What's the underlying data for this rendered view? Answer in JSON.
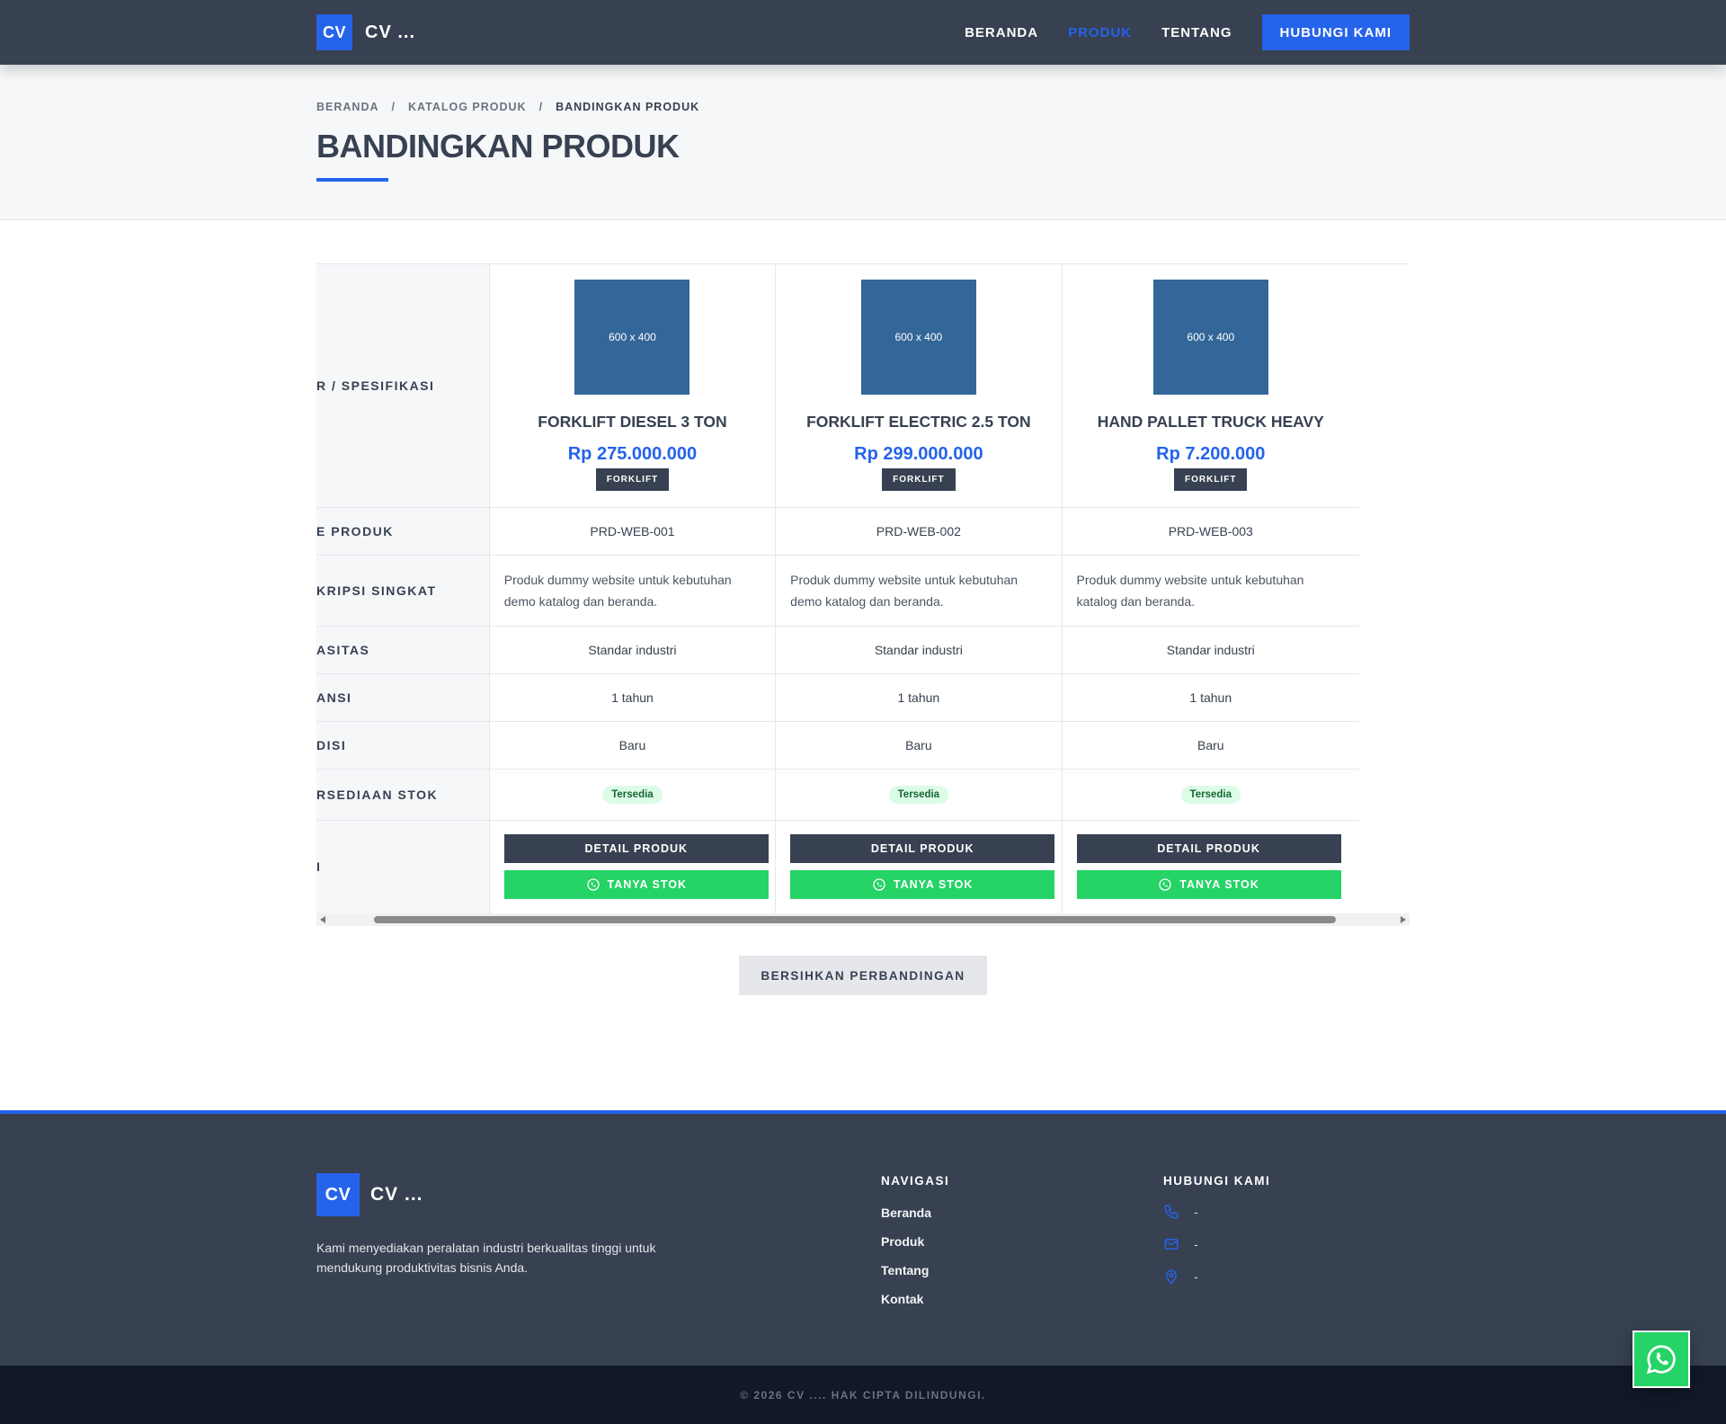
{
  "header": {
    "logo": "CV",
    "brand": "CV ...",
    "nav": [
      "BERANDA",
      "PRODUK",
      "TENTANG"
    ],
    "cta": "HUBUNGI KAMI"
  },
  "breadcrumb": [
    "BERANDA",
    "KATALOG PRODUK",
    "BANDINGKAN PRODUK"
  ],
  "page_title": "BANDINGKAN PRODUK",
  "compare": {
    "row_labels": {
      "header": "R / SPESIFIKASI",
      "code": "E PRODUK",
      "desc": "KRIPSI SINGKAT",
      "capacity": "ASITAS",
      "warranty": "ANSI",
      "condition": "DISI",
      "stock": "RSEDIAAN STOK",
      "action": "I"
    },
    "products": [
      {
        "image": "600 x 400",
        "name": "FORKLIFT DIESEL 3 TON",
        "price": "Rp 275.000.000",
        "category": "FORKLIFT",
        "code": "PRD-WEB-001",
        "desc_1": "Produk dummy website untuk kebutuhan",
        "desc_2": "demo katalog dan beranda.",
        "capacity": "Standar industri",
        "warranty": "1 tahun",
        "condition": "Baru",
        "stock": "Tersedia"
      },
      {
        "image": "600 x 400",
        "name": "FORKLIFT ELECTRIC 2.5 TON",
        "price": "Rp 299.000.000",
        "category": "FORKLIFT",
        "code": "PRD-WEB-002",
        "desc_1": "Produk dummy website untuk kebutuhan",
        "desc_2": "demo katalog dan beranda.",
        "capacity": "Standar industri",
        "warranty": "1 tahun",
        "condition": "Baru",
        "stock": "Tersedia"
      },
      {
        "image": "600 x 400",
        "name": "HAND PALLET TRUCK HEAVY",
        "price": "Rp 7.200.000",
        "category": "FORKLIFT",
        "code": "PRD-WEB-003",
        "desc_1": "Produk dummy website untuk kebutuhan",
        "desc_2": "katalog dan beranda.",
        "capacity": "Standar industri",
        "warranty": "1 tahun",
        "condition": "Baru",
        "stock": "Tersedia"
      }
    ],
    "detail_label": "DETAIL PRODUK",
    "ask_label": "TANYA STOK"
  },
  "clear_label": "BERSIHKAN PERBANDINGAN",
  "footer": {
    "logo": "CV",
    "brand": "CV ...",
    "desc_1": "Kami menyediakan peralatan industri berkualitas tinggi untuk",
    "desc_2": "mendukung produktivitas bisnis Anda.",
    "nav_title": "NAVIGASI",
    "nav_links": [
      "Beranda",
      "Produk",
      "Tentang",
      "Kontak"
    ],
    "contact_title": "HUBUNGI KAMI",
    "phone": "-",
    "email": "-",
    "address": "-",
    "copyright": "© 2026 CV .... HAK CIPTA DILINDUNGI."
  },
  "colors": {
    "primary": "#2563eb",
    "dark": "#374151",
    "whatsapp": "#25d366",
    "placeholder": "#336699"
  },
  "icons": [
    "whatsapp-icon",
    "phone-icon",
    "mail-icon",
    "map-pin-icon"
  ]
}
